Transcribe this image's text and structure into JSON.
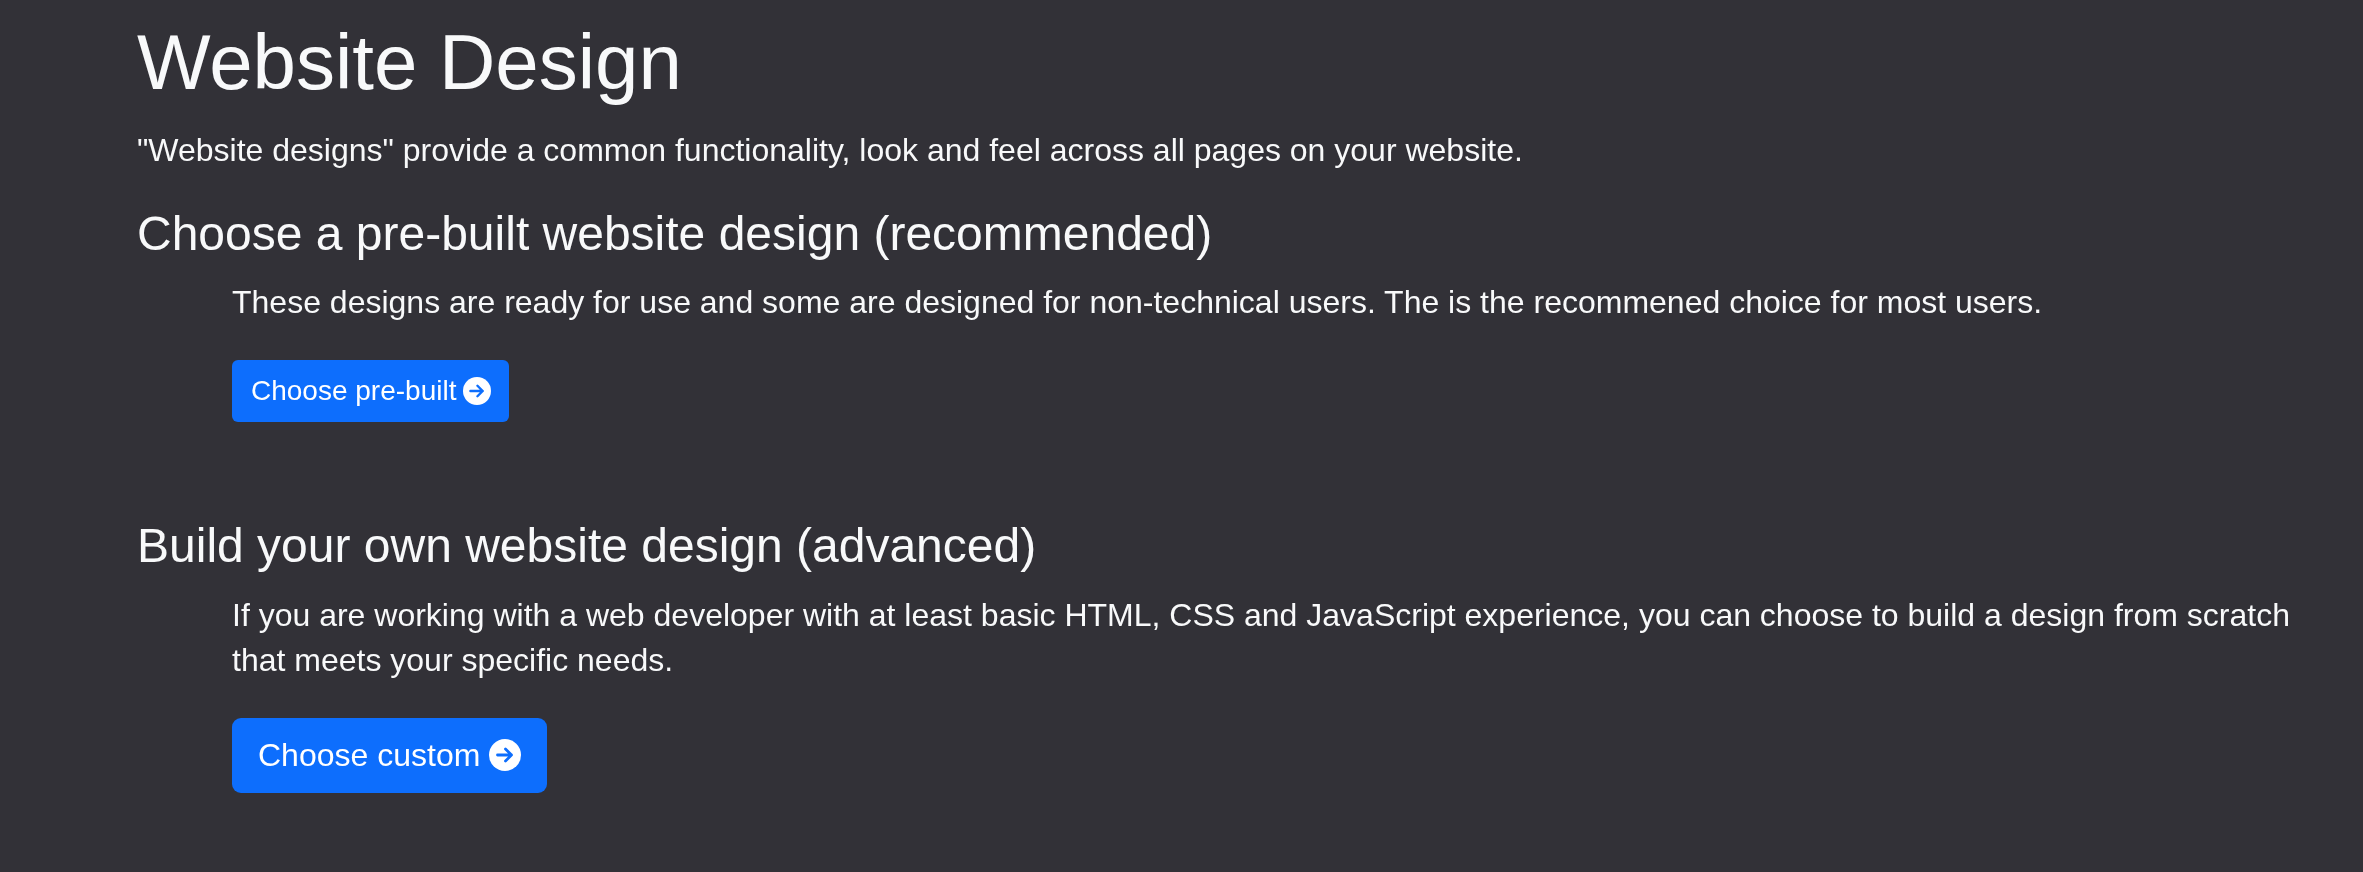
{
  "page": {
    "title": "Website Design",
    "intro": "\"Website designs\" provide a common functionality, look and feel across all pages on your website."
  },
  "sections": [
    {
      "heading": "Choose a pre-built website design (recommended)",
      "description": "These designs are ready for use and some are designed for non-technical users. The is the recommened choice for most users.",
      "button": {
        "label": "Choose pre-built",
        "kind": "regular"
      }
    },
    {
      "heading": "Build your own website design (advanced)",
      "description": "If you are working with a web developer with at least basic HTML, CSS and JavaScript experience, you can choose to build a design from scratch that meets your specific needs.",
      "button": {
        "label": "Choose custom",
        "kind": "large"
      }
    }
  ]
}
